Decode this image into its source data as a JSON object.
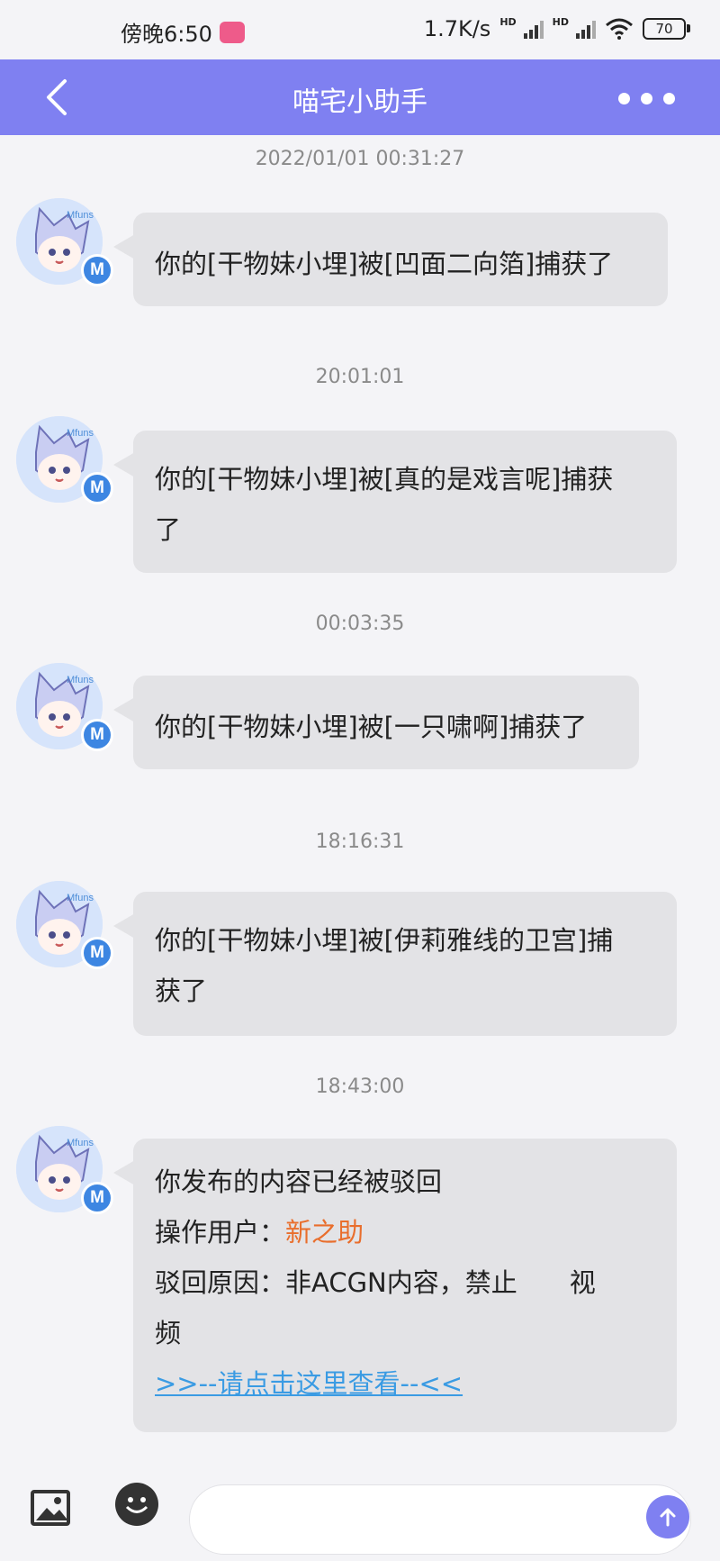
{
  "status_bar": {
    "time": "傍晚6:50",
    "app_icon": "bilibili-icon",
    "network_speed": "1.7K/s",
    "hd_label": "HD",
    "battery": "70"
  },
  "header": {
    "title": "喵宅小助手",
    "back_icon": "chevron-left-icon",
    "more_icon": "more-dots-icon",
    "bar_color": "#7f80f1"
  },
  "avatar": {
    "label": "Mfuns",
    "badge": "M"
  },
  "messages": [
    {
      "timestamp": "2022/01/01 00:31:27",
      "lines": [
        "你的[干物妹小埋]被[凹面二向箔]捕获了"
      ]
    },
    {
      "timestamp": "20:01:01",
      "lines": [
        "你的[干物妹小埋]被[真的是戏言呢]捕获",
        "了"
      ]
    },
    {
      "timestamp": "00:03:35",
      "lines": [
        "你的[干物妹小埋]被[一只啸啊]捕获了"
      ]
    },
    {
      "timestamp": "18:16:31",
      "lines": [
        "你的[干物妹小埋]被[伊莉雅线的卫宫]捕",
        "获了"
      ]
    },
    {
      "timestamp": "18:43:00",
      "line1": "你发布的内容已经被驳回",
      "operator_label": "操作用户：",
      "operator_name": "新之助",
      "reason_label": "驳回原因：非ACGN内容，禁止　　视",
      "reason_cont": "频",
      "link": ">>--请点击这里查看--<<"
    }
  ],
  "input_bar": {
    "image_icon": "image-icon",
    "emoji_icon": "emoji-icon",
    "send_icon": "arrow-up-icon",
    "placeholder": ""
  },
  "colors": {
    "accent": "#7f80f1",
    "operator": "#e96e2c",
    "link": "#3a9be3"
  }
}
